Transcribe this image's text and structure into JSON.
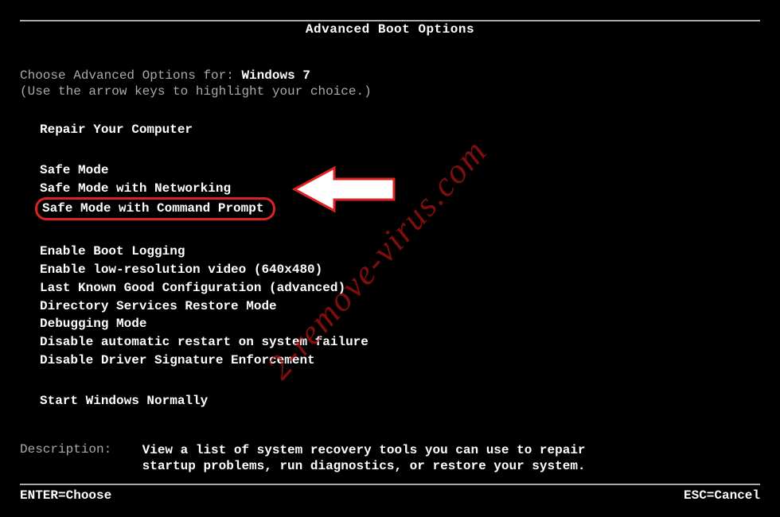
{
  "title": "Advanced Boot Options",
  "choose_prefix": "Choose Advanced Options for: ",
  "os_name": "Windows 7",
  "hint": "(Use the arrow keys to highlight your choice.)",
  "menu": {
    "repair": "Repair Your Computer",
    "safe_mode": "Safe Mode",
    "safe_mode_net": "Safe Mode with Networking",
    "safe_mode_cmd": "Safe Mode with Command Prompt",
    "boot_logging": "Enable Boot Logging",
    "low_res": "Enable low-resolution video (640x480)",
    "lkgc": "Last Known Good Configuration (advanced)",
    "dsrm": "Directory Services Restore Mode",
    "debug": "Debugging Mode",
    "no_auto_restart": "Disable automatic restart on system failure",
    "no_driver_sig": "Disable Driver Signature Enforcement",
    "start_normal": "Start Windows Normally"
  },
  "description": {
    "label": "Description:    ",
    "text": "View a list of system recovery tools you can use to repair startup problems, run diagnostics, or restore your system."
  },
  "footer": {
    "enter": "ENTER=Choose",
    "esc": "ESC=Cancel"
  },
  "watermark": "2-remove-virus.com"
}
